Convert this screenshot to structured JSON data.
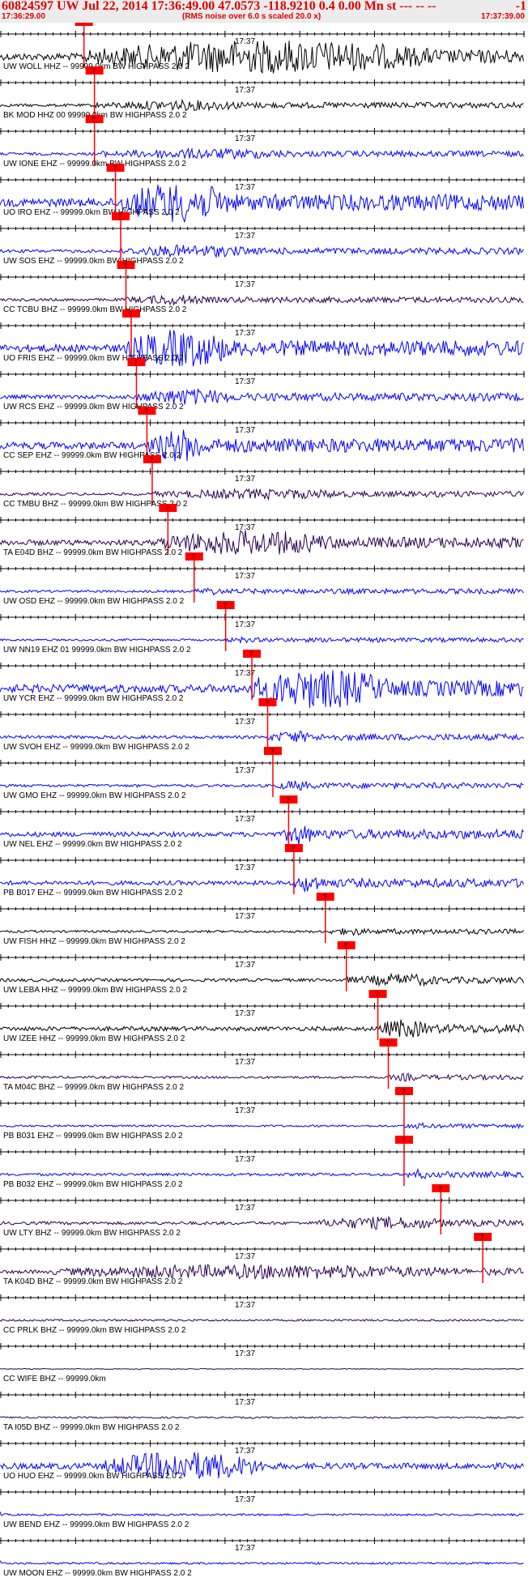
{
  "header": {
    "title": "60824597 UW Jul 22, 2014 17:36:49.00   47.0573 -118.9210  0.4 0.00 Mn st --- -- --",
    "neg": "-1",
    "time_start": "17:36:29.00",
    "subtitle": "(RMS noise over 6.0 s scaled 20.0 x)",
    "time_end": "17:37:39.00"
  },
  "colors": {
    "header": "#e00000",
    "blue": "#0000ff",
    "purple": "#2a0050",
    "black": "#000000",
    "pick": "#ff0000"
  },
  "chart_data": {
    "type": "line",
    "x_unit": "time",
    "xlim": [
      "17:36:29.00",
      "17:37:39.00"
    ],
    "mid_tick_label": "17:37",
    "pick_label": "?",
    "traces": [
      {
        "label": "UW WOLL HHZ -- 99999.0km BW  HIGHPASS  2.0  2",
        "color": "black",
        "pick": 0.16,
        "amp": 0.8,
        "burst": [
          0.17,
          0.85
        ]
      },
      {
        "label": "BK MOD HHZ 00 99999.0km BW  HIGHPASS  2.0  2",
        "color": "black",
        "pick": 0.18,
        "amp": 0.25,
        "burst": [
          0.2,
          0.5
        ]
      },
      {
        "label": "UW IONE EHZ -- 99999.0km BW  HIGHPASS  2.0  2",
        "color": "blue",
        "pick": 0.18,
        "amp": 0.25,
        "burst": [
          0.2,
          0.6
        ]
      },
      {
        "label": "UO IRO EHZ -- 99999.0km BW  HIGHPASS  2.0  2",
        "color": "blue",
        "pick": 0.22,
        "amp": 0.95,
        "burst": [
          0.23,
          0.45
        ]
      },
      {
        "label": "UW SOS EHZ -- 99999.0km BW  HIGHPASS  2.0  2",
        "color": "blue",
        "pick": 0.23,
        "amp": 0.3,
        "burst": [
          0.24,
          0.5
        ]
      },
      {
        "label": "CC TCBU BHZ -- 99999.0km BW  HIGHPASS  2.0  2",
        "color": "purple",
        "pick": 0.24,
        "amp": 0.25,
        "burst": [
          0.26,
          0.4
        ]
      },
      {
        "label": "UO FRIS EHZ -- 99999.0km BW  HIGHPASS  2.0  2",
        "color": "blue",
        "pick": 0.25,
        "amp": 0.9,
        "burst": [
          0.24,
          0.45
        ]
      },
      {
        "label": "UW RCS EHZ -- 99999.0km BW  HIGHPASS  2.0  2",
        "color": "blue",
        "pick": 0.26,
        "amp": 0.4,
        "burst": [
          0.27,
          0.45
        ]
      },
      {
        "label": "CC SEP EHZ -- 99999.0km BW  HIGHPASS  2.0  2",
        "color": "blue",
        "pick": 0.28,
        "amp": 0.8,
        "burst": [
          0.29,
          0.4
        ]
      },
      {
        "label": "CC TMBU BHZ -- 99999.0km BW  HIGHPASS  2.0  2",
        "color": "purple",
        "pick": 0.29,
        "amp": 0.25,
        "burst": [
          0.3,
          0.7
        ]
      },
      {
        "label": "TA E04D BHZ -- 99999.0km BW  HIGHPASS  2.0  2",
        "color": "purple",
        "pick": 0.32,
        "amp": 0.6,
        "burst": [
          0.3,
          0.65
        ]
      },
      {
        "label": "UW OSD EHZ -- 99999.0km BW  HIGHPASS  2.0  2",
        "color": "blue",
        "pick": 0.37,
        "amp": 0.2,
        "burst": [
          0.38,
          0.42
        ]
      },
      {
        "label": "UW NN19 EHZ 01 99999.0km BW  HIGHPASS  2.0  2",
        "color": "blue",
        "pick": 0.43,
        "amp": 0.15,
        "burst": [
          0.44,
          0.48
        ]
      },
      {
        "label": "UW YCR EHZ -- 99999.0km BW  HIGHPASS  2.0  2",
        "color": "blue",
        "pick": 0.48,
        "amp": 0.95,
        "burst": [
          0.47,
          0.75
        ]
      },
      {
        "label": "UW SVOH EHZ -- 99999.0km BW  HIGHPASS  2.0  2",
        "color": "blue",
        "pick": 0.51,
        "amp": 0.3,
        "burst": [
          0.52,
          0.6
        ]
      },
      {
        "label": "UW GMO EHZ -- 99999.0km BW  HIGHPASS  2.0  2",
        "color": "blue",
        "pick": 0.52,
        "amp": 0.25,
        "burst": [
          0.53,
          0.6
        ]
      },
      {
        "label": "UW NEL EHZ -- 99999.0km BW  HIGHPASS  2.0  2",
        "color": "blue",
        "pick": 0.55,
        "amp": 0.5,
        "burst": [
          0.54,
          0.6
        ]
      },
      {
        "label": "PB B017 EHZ -- 99999.0km BW  HIGHPASS  2.0  2",
        "color": "blue",
        "pick": 0.56,
        "amp": 0.45,
        "burst": [
          0.56,
          0.62
        ]
      },
      {
        "label": "UW FISH HHZ -- 99999.0km BW  HIGHPASS  2.0  2",
        "color": "black",
        "pick": 0.62,
        "amp": 0.2,
        "burst": [
          0.64,
          0.7
        ]
      },
      {
        "label": "UW LEBA HHZ -- 99999.0km BW  HIGHPASS  2.0  2",
        "color": "black",
        "pick": 0.66,
        "amp": 0.3,
        "burst": [
          0.68,
          0.85
        ]
      },
      {
        "label": "UW IZEE HHZ -- 99999.0km BW  HIGHPASS  2.0  2",
        "color": "black",
        "pick": 0.72,
        "amp": 0.45,
        "burst": [
          0.72,
          0.82
        ]
      },
      {
        "label": "TA M04C BHZ -- 99999.0km BW  HIGHPASS  2.0  2",
        "color": "purple",
        "pick": 0.74,
        "amp": 0.2,
        "burst": [
          0.75,
          0.8
        ]
      },
      {
        "label": "PB B031 EHZ -- 99999.0km BW  HIGHPASS  2.0  2",
        "color": "blue",
        "pick": 0.77,
        "amp": 0.15,
        "burst": [
          0.78,
          0.82
        ]
      },
      {
        "label": "PB B032 EHZ -- 99999.0km BW  HIGHPASS  2.0  2",
        "color": "blue",
        "pick": 0.77,
        "amp": 0.25,
        "burst": [
          0.78,
          0.82
        ]
      },
      {
        "label": "UW LTY BHZ -- 99999.0km BW  HIGHPASS  2.0  2",
        "color": "purple",
        "pick": 0.84,
        "amp": 0.3,
        "burst": [
          0.6,
          0.87
        ]
      },
      {
        "label": "TA K04D BHZ -- 99999.0km BW  HIGHPASS  2.0  2",
        "color": "purple",
        "pick": 0.92,
        "amp": 0.35,
        "burst": [
          0.1,
          0.9
        ]
      },
      {
        "label": "CC PRLK BHZ -- 99999.0km BW  HIGHPASS  2.0  2",
        "color": "purple",
        "pick": null,
        "amp": 0.15,
        "burst": [
          0,
          0
        ]
      },
      {
        "label": "CC WIFE BHZ -- 99999.0km",
        "color": "purple",
        "pick": null,
        "amp": 0.0,
        "burst": [
          0,
          0
        ]
      },
      {
        "label": "TA I05D BHZ -- 99999.0km BW  HIGHPASS  2.0  2",
        "color": "purple",
        "pick": null,
        "amp": 0.12,
        "burst": [
          0,
          0
        ]
      },
      {
        "label": "UO HUO EHZ -- 99999.0km BW  HIGHPASS  2.0  2",
        "color": "blue",
        "pick": null,
        "amp": 0.7,
        "burst": [
          0.2,
          0.5
        ]
      },
      {
        "label": "UW BEND EHZ -- 99999.0km BW  HIGHPASS  2.0  2",
        "color": "blue",
        "pick": null,
        "amp": 0.15,
        "burst": [
          0,
          0
        ]
      },
      {
        "label": "UW MOON EHZ -- 99999.0km BW  HIGHPASS  2.0  2",
        "color": "blue",
        "pick": null,
        "amp": 0.15,
        "burst": [
          0,
          0
        ]
      }
    ]
  }
}
